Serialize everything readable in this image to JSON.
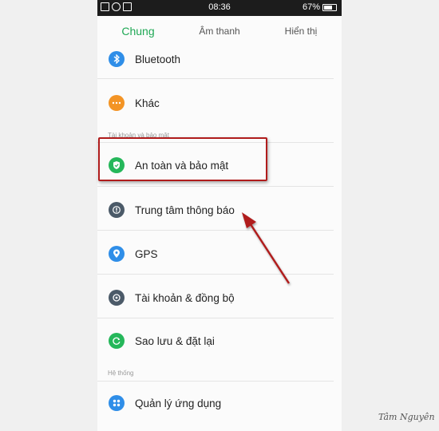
{
  "status_bar": {
    "time": "08:36",
    "battery": "67%"
  },
  "tabs": [
    {
      "label": "Chung"
    },
    {
      "label": "Âm thanh"
    },
    {
      "label": "Hiển thị"
    }
  ],
  "items": [
    {
      "label": "Bluetooth",
      "icon": "bluetooth-icon",
      "color": "#2f8ee8"
    },
    {
      "label": "Khác",
      "icon": "more-icon",
      "color": "#f39425"
    },
    {
      "label": "An toàn và bảo mật",
      "icon": "shield-icon",
      "color": "#25b75a"
    },
    {
      "label": "Trung tâm thông báo",
      "icon": "notification-icon",
      "color": "#4b5a68"
    },
    {
      "label": "GPS",
      "icon": "location-icon",
      "color": "#2f8ee8"
    },
    {
      "label": "Tài khoản & đồng bộ",
      "icon": "sync-icon",
      "color": "#4b5a68"
    },
    {
      "label": "Sao lưu & đặt lại",
      "icon": "backup-icon",
      "color": "#25b75a"
    },
    {
      "label": "Quản lý ứng dụng",
      "icon": "apps-icon",
      "color": "#2f8ee8"
    }
  ],
  "sections": {
    "account": "Tài khoản và bảo mật",
    "system": "Hệ thống"
  },
  "watermark": "Tâm Nguyên",
  "colors": {
    "accent": "#1fa855",
    "annotation": "#b01c1c"
  }
}
